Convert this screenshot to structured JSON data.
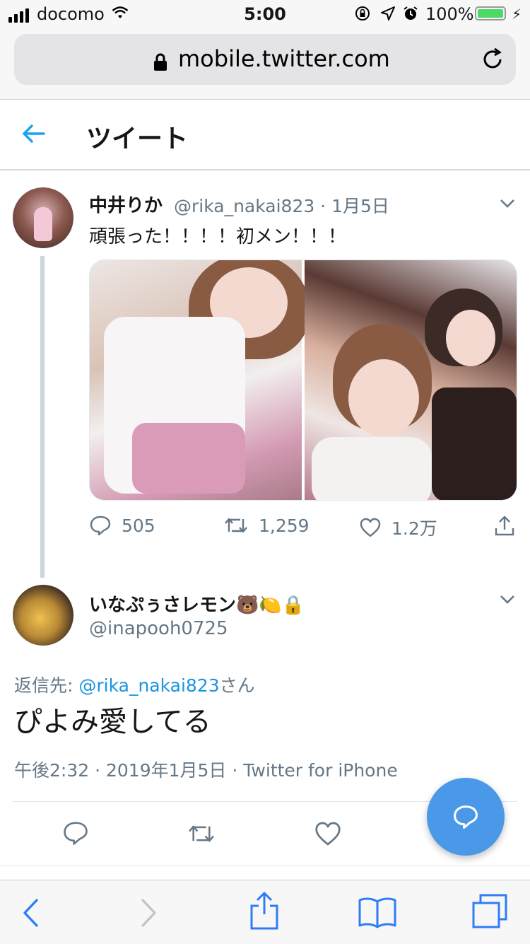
{
  "status_bar": {
    "carrier": "docomo",
    "time": "5:00",
    "battery": "100%"
  },
  "browser": {
    "url": "mobile.twitter.com"
  },
  "header": {
    "title": "ツイート"
  },
  "tweet1": {
    "name": "中井りか",
    "handle": "@rika_nakai823",
    "date": "1月5日",
    "meta": "@rika_nakai823 · 1月5日",
    "text": "頑張った！！！！初メン！！！",
    "replies": "505",
    "retweets": "1,259",
    "likes": "1.2万"
  },
  "tweet2": {
    "name": "いなぷぅさレモン🐻🍋🔒",
    "handle": "@inapooh0725",
    "reply_prefix": "返信先: ",
    "reply_mention": "@rika_nakai823",
    "reply_suffix": "さん",
    "text": "ぴよみ愛してる",
    "timestamp": "午後2:32 · 2019年1月5日 · Twitter for iPhone"
  },
  "colors": {
    "twitter_blue": "#1da1f2",
    "fab_blue": "#4a99e9",
    "link_blue": "#1b95e0",
    "muted_gray": "#657786",
    "safari_blue": "#2f7cf6"
  }
}
